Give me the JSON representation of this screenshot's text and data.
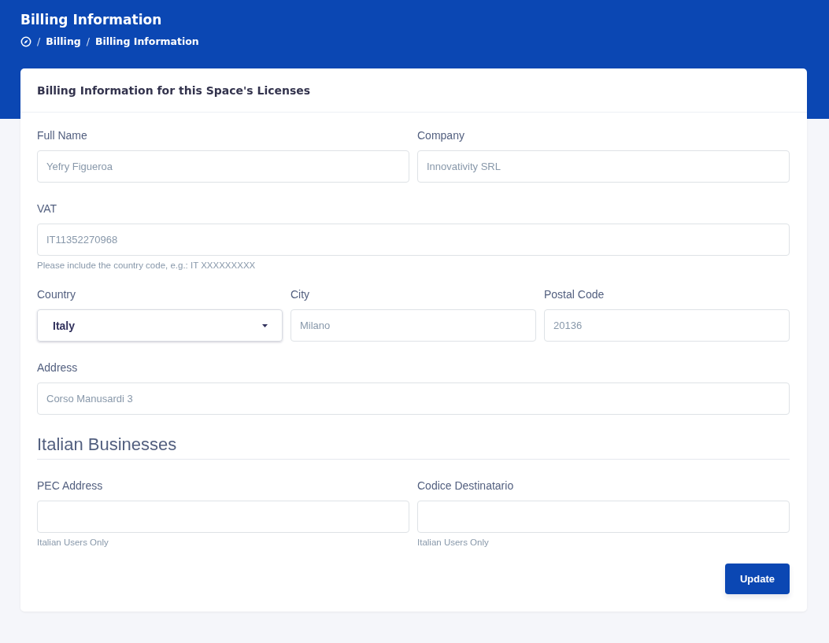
{
  "header": {
    "title": "Billing Information",
    "breadcrumb": [
      {
        "separator": "/",
        "label": "Billing"
      },
      {
        "separator": "/",
        "label": "Billing Information"
      }
    ]
  },
  "card": {
    "title": "Billing Information for this Space's Licenses",
    "rows": [
      {
        "fields": [
          {
            "kind": "text",
            "label": "Full Name",
            "value": "Yefry Figueroa"
          },
          {
            "kind": "text",
            "label": "Company",
            "value": "Innovativity SRL"
          }
        ]
      },
      {
        "fields": [
          {
            "kind": "text",
            "label": "VAT",
            "value": "IT11352270968",
            "help": "Please include the country code, e.g.: IT XXXXXXXXX"
          }
        ]
      },
      {
        "fields": [
          {
            "kind": "select",
            "label": "Country",
            "value": "Italy"
          },
          {
            "kind": "text",
            "label": "City",
            "value": "Milano"
          },
          {
            "kind": "text",
            "label": "Postal Code",
            "value": "20136"
          }
        ]
      },
      {
        "fields": [
          {
            "kind": "text",
            "label": "Address",
            "value": "Corso Manusardi 3"
          }
        ]
      }
    ],
    "section": {
      "title": "Italian Businesses",
      "rows": [
        {
          "fields": [
            {
              "kind": "text",
              "label": "PEC Address",
              "help": "Italian Users Only"
            },
            {
              "kind": "text",
              "label": "Codice Destinatario",
              "help": "Italian Users Only"
            }
          ]
        }
      ]
    },
    "button": "Update"
  }
}
